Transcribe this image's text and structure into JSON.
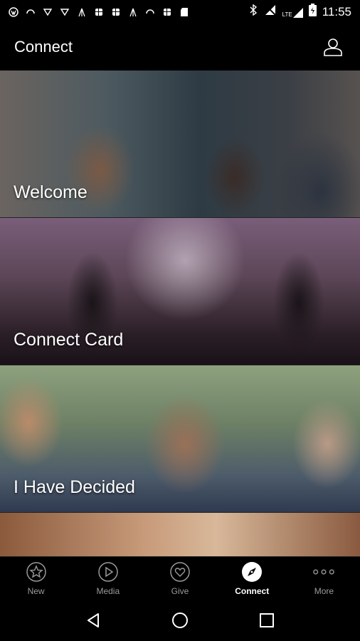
{
  "status_bar": {
    "time": "11:55",
    "network": "LTE"
  },
  "app_bar": {
    "title": "Connect"
  },
  "cards": [
    {
      "label": "Welcome"
    },
    {
      "label": "Connect Card"
    },
    {
      "label": "I Have Decided"
    },
    {
      "label": ""
    }
  ],
  "bottom_nav": {
    "items": [
      {
        "label": "New",
        "icon": "star-icon",
        "active": false
      },
      {
        "label": "Media",
        "icon": "play-icon",
        "active": false
      },
      {
        "label": "Give",
        "icon": "heart-icon",
        "active": false
      },
      {
        "label": "Connect",
        "icon": "compass-icon",
        "active": true
      },
      {
        "label": "More",
        "icon": "more-icon",
        "active": false
      }
    ]
  },
  "colors": {
    "background": "#000000",
    "active": "#ffffff",
    "inactive": "#9a9a9a"
  }
}
